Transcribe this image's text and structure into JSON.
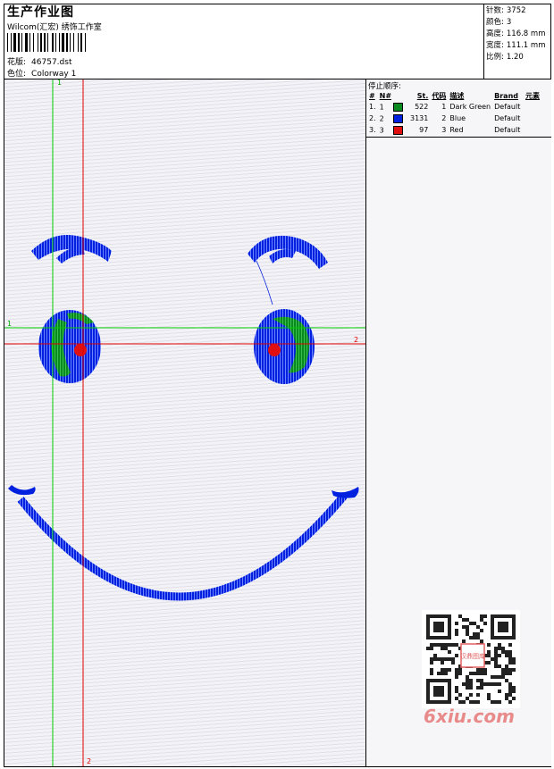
{
  "header": {
    "title": "生产作业图",
    "company": "Wilcom(汇宏) 绣饰工作室",
    "design_label": "花版:",
    "design_value": "46757.dst",
    "colorway_label": "色位:",
    "colorway_value": "Colorway 1"
  },
  "stats": [
    {
      "label": "针数:",
      "value": "3752"
    },
    {
      "label": "颜色:",
      "value": "3"
    },
    {
      "label": "高度:",
      "value": "116.8 mm"
    },
    {
      "label": "宽度:",
      "value": "111.1 mm"
    },
    {
      "label": "比例:",
      "value": "1.20"
    }
  ],
  "stop_sequence": {
    "title": "停止顺序:",
    "columns": [
      "#",
      "N#",
      "St.",
      "代码",
      "描述",
      "Brand",
      "元素"
    ],
    "rows": [
      {
        "index": "1.",
        "n": "1",
        "color": "#0a8a1e",
        "stitches": "522",
        "code": "1",
        "desc": "Dark Green",
        "brand": "Default",
        "element": ""
      },
      {
        "index": "2.",
        "n": "2",
        "color": "#0020e0",
        "stitches": "3131",
        "code": "2",
        "desc": "Blue",
        "brand": "Default",
        "element": ""
      },
      {
        "index": "3.",
        "n": "3",
        "color": "#e01010",
        "stitches": "97",
        "code": "3",
        "desc": "Red",
        "brand": "Default",
        "element": ""
      }
    ]
  },
  "guides": {
    "v1": "1",
    "v2": "2",
    "h1": "1",
    "h2": "2"
  },
  "watermark": "6xiu.com",
  "qr_stamp": "汉鼎图库",
  "colors": {
    "thread_blue": "#0020e0",
    "thread_green": "#0a8a1e",
    "thread_red": "#e01010",
    "guide_green": "#00cc00",
    "guide_red": "#e00000"
  }
}
